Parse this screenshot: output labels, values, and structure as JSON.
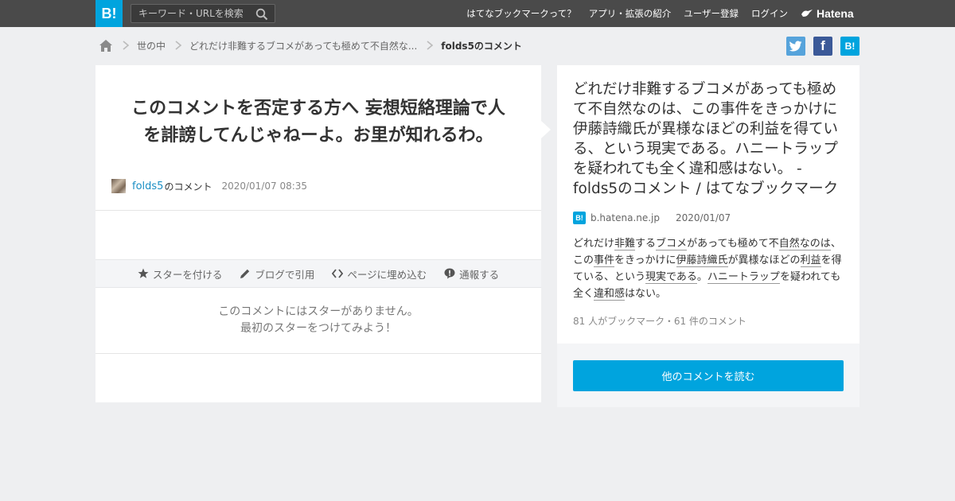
{
  "header": {
    "logo": "B!",
    "search_placeholder": "キーワード・URLを検索",
    "nav": [
      "はてなブックマークって？",
      "アプリ・拡張の紹介",
      "ユーザー登録",
      "ログイン"
    ],
    "brand": "Hatena"
  },
  "breadcrumb": {
    "items": [
      "世の中",
      "どれだけ非難するブコメがあっても極めて不自然な...",
      "folds5のコメント"
    ]
  },
  "share": {
    "facebook": "f",
    "hatena": "B!"
  },
  "comment": {
    "line1": "このコメントを否定する方へ 妄想短絡理論で人",
    "line2": "を誹謗してんじゃねーよ。お里が知れるわ。",
    "user": "folds5",
    "user_suffix": "のコメント",
    "timestamp": "2020/01/07 08:35"
  },
  "actions": [
    "スターを付ける",
    "ブログで引用",
    "ページに埋め込む",
    "通報する"
  ],
  "stars": {
    "line1": "このコメントにはスターがありません。",
    "line2": "最初のスターをつけてみよう！"
  },
  "entry": {
    "title": "どれだけ非難するブコメがあっても極めて不自然なのは、この事件をきっかけに伊藤詩織氏が異様なほどの利益を得ている、という現実である。ハニートラップを疑われても全く違和感はない。 - folds5のコメント / はてなブックマーク",
    "favicon": "B!",
    "domain": "b.hatena.ne.jp",
    "date": "2020/01/07",
    "summary": {
      "s1": "どれだけ",
      "s2": "非難",
      "s3": "する",
      "s4": "ブコメ",
      "s5": "があっても極めて不",
      "s6": "自然",
      "s7": "なの",
      "s8": "は",
      "s9": "、この",
      "s10": "事件",
      "s11": "をきっかけに",
      "s12": "伊藤詩織氏",
      "s13": "が異様なほどの",
      "s14": "利益",
      "s15": "を得ている、という",
      "s16": "現実",
      "s17": "である",
      "s18": "。",
      "s19": "ハニートラップ",
      "s20": "を疑われても全く",
      "s21": "違和感",
      "s22": "はない。"
    },
    "counts": "81 人がブックマーク・61 件のコメント",
    "read_button": "他のコメントを読む"
  }
}
